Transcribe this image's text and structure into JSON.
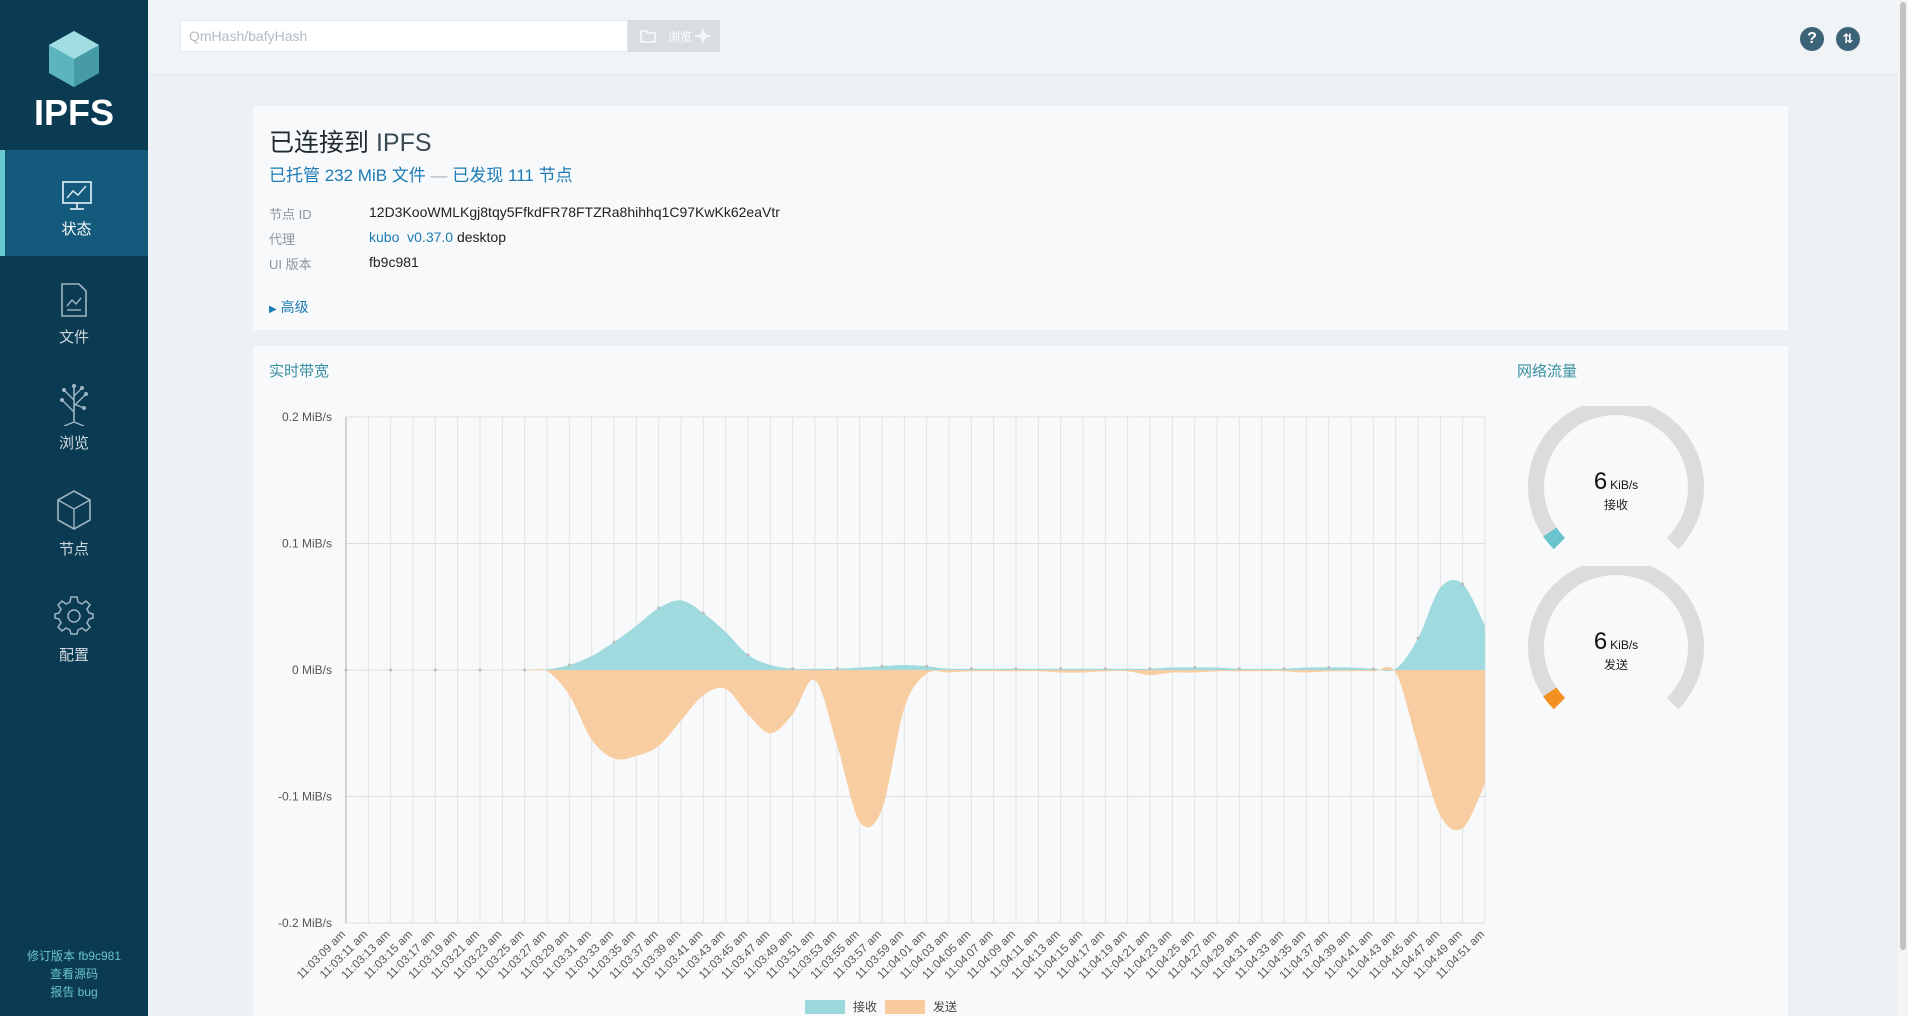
{
  "app": {
    "name": "IPFS"
  },
  "sidebar": {
    "items": [
      {
        "key": "status",
        "label": "状态",
        "icon": "status-monitor-icon",
        "active": true
      },
      {
        "key": "files",
        "label": "文件",
        "icon": "files-icon",
        "active": false
      },
      {
        "key": "explore",
        "label": "浏览",
        "icon": "explore-tree-icon",
        "active": false
      },
      {
        "key": "peers",
        "label": "节点",
        "icon": "peers-cube-icon",
        "active": false
      },
      {
        "key": "settings",
        "label": "配置",
        "icon": "gear-icon",
        "active": false
      }
    ],
    "footer": {
      "revision": "修订版本 fb9c981",
      "source": "查看源码",
      "bug": "报告 bug"
    }
  },
  "topbar": {
    "search_placeholder": "QmHash/bafyHash",
    "browse_label": "浏览",
    "help_icon": "help-icon",
    "connection_icon": "connection-arrows-icon"
  },
  "status": {
    "title_prefix": "已连接到",
    "title_name": "IPFS",
    "hosting": "已托管 232 MiB 文件",
    "separator": "—",
    "discovered": "已发现 111 节点",
    "rows": {
      "peer_id_key": "节点 ID",
      "peer_id_val": "12D3KooWMLKgj8tqy5FfkdFR78FTZRa8hihhq1C97KwKk62eaVtr",
      "agent_key": "代理",
      "agent_kubo": "kubo",
      "agent_version": "v0.37.0",
      "agent_desktop": "desktop",
      "ui_key": "UI 版本",
      "ui_val": "fb9c981"
    },
    "advanced": "高级"
  },
  "bandwidth": {
    "title": "实时带宽",
    "traffic_title": "网络流量",
    "gauges": [
      {
        "value": "6",
        "unit": "KiB/s",
        "label": "接收",
        "color": "#69c4cd",
        "fill": 0.04
      },
      {
        "value": "6",
        "unit": "KiB/s",
        "label": "发送",
        "color": "#f39021",
        "fill": 0.04
      }
    ]
  },
  "chart_data": {
    "type": "area",
    "ylabel": "",
    "y_ticks": [
      "0.2 MiB/s",
      "0.1 MiB/s",
      "0 MiB/s",
      "-0.1 MiB/s",
      "-0.2 MiB/s"
    ],
    "ylim": [
      -0.2,
      0.2
    ],
    "grid": true,
    "legend_position": "bottom",
    "x": [
      "11:03:09 am",
      "11:03:11 am",
      "11:03:13 am",
      "11:03:15 am",
      "11:03:17 am",
      "11:03:19 am",
      "11:03:21 am",
      "11:03:23 am",
      "11:03:25 am",
      "11:03:27 am",
      "11:03:29 am",
      "11:03:31 am",
      "11:03:33 am",
      "11:03:35 am",
      "11:03:37 am",
      "11:03:39 am",
      "11:03:41 am",
      "11:03:43 am",
      "11:03:45 am",
      "11:03:47 am",
      "11:03:49 am",
      "11:03:51 am",
      "11:03:53 am",
      "11:03:55 am",
      "11:03:57 am",
      "11:03:59 am",
      "11:04:01 am",
      "11:04:03 am",
      "11:04:05 am",
      "11:04:07 am",
      "11:04:09 am",
      "11:04:11 am",
      "11:04:13 am",
      "11:04:15 am",
      "11:04:17 am",
      "11:04:19 am",
      "11:04:21 am",
      "11:04:23 am",
      "11:04:25 am",
      "11:04:27 am",
      "11:04:29 am",
      "11:04:31 am",
      "11:04:33 am",
      "11:04:35 am",
      "11:04:37 am",
      "11:04:39 am",
      "11:04:41 am",
      "11:04:43 am",
      "11:04:45 am",
      "11:04:47 am",
      "11:04:49 am",
      "11:04:51 am"
    ],
    "series": [
      {
        "name": "接收",
        "color": "#9ad8dc",
        "values": [
          0,
          0,
          0,
          0,
          0,
          0,
          0,
          0,
          0,
          0.0005,
          0.004,
          0.011,
          0.022,
          0.035,
          0.049,
          0.055,
          0.045,
          0.03,
          0.012,
          0.004,
          0.001,
          0.001,
          0.001,
          0.002,
          0.003,
          0.004,
          0.003,
          0.001,
          0.001,
          0.001,
          0.001,
          0.001,
          0.001,
          0.001,
          0.001,
          0.001,
          0.001,
          0.002,
          0.002,
          0.002,
          0.001,
          0.001,
          0.001,
          0.002,
          0.002,
          0.002,
          0.001,
          0.001,
          0.025,
          0.065,
          0.068,
          0.035,
          0.006
        ]
      },
      {
        "name": "发送",
        "color": "#f8ca9c",
        "values": [
          0,
          0,
          0,
          0,
          0,
          0,
          0,
          0,
          0,
          -0.001,
          -0.02,
          -0.055,
          -0.07,
          -0.068,
          -0.06,
          -0.04,
          -0.02,
          -0.015,
          -0.035,
          -0.05,
          -0.035,
          -0.008,
          -0.06,
          -0.12,
          -0.11,
          -0.03,
          -0.003,
          -0.002,
          -0.001,
          -0.001,
          -0.001,
          -0.001,
          -0.002,
          -0.002,
          -0.001,
          -0.001,
          -0.004,
          -0.002,
          -0.002,
          -0.001,
          -0.001,
          -0.001,
          -0.001,
          -0.002,
          -0.001,
          -0.001,
          -0.001,
          -0.002,
          -0.06,
          -0.115,
          -0.125,
          -0.09,
          -0.005
        ]
      }
    ]
  }
}
